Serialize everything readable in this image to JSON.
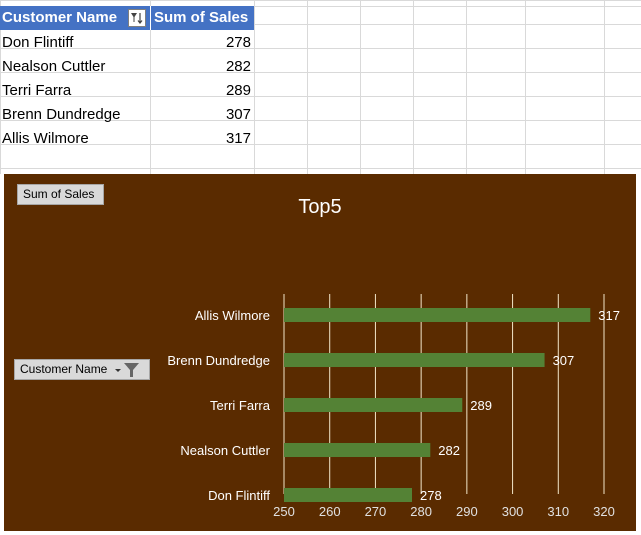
{
  "pivot_table": {
    "header_name": "Customer Name",
    "header_sum": "Sum of Sales",
    "rows": [
      {
        "name": "Don Flintiff",
        "value": "278"
      },
      {
        "name": "Nealson Cuttler",
        "value": "282"
      },
      {
        "name": "Terri Farra",
        "value": "289"
      },
      {
        "name": "Brenn Dundredge",
        "value": "307"
      },
      {
        "name": "Allis Wilmore",
        "value": "317"
      }
    ]
  },
  "chart_buttons": {
    "values_field": "Sum of Sales",
    "axis_field": "Customer Name"
  },
  "chart_data": {
    "type": "bar",
    "orientation": "horizontal",
    "title": "Top5",
    "categories": [
      "Allis Wilmore",
      "Brenn Dundredge",
      "Terri Farra",
      "Nealson Cuttler",
      "Don Flintiff"
    ],
    "values": [
      317,
      307,
      289,
      282,
      278
    ],
    "xlim": [
      250,
      320
    ],
    "x_ticks": [
      250,
      260,
      270,
      280,
      290,
      300,
      310,
      320
    ],
    "grid": true,
    "data_labels": true,
    "bar_color": "#548235",
    "background_color": "#5a2b00"
  }
}
